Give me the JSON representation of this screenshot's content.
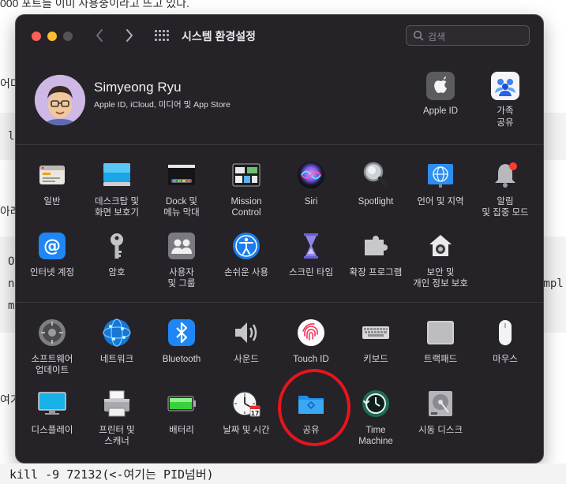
{
  "background": {
    "top_text": "000 포트를 이미 사용중이라고 뜨고 있다.",
    "left_fragments": [
      "어미",
      "l",
      "아래",
      "O",
      "n",
      "m",
      "여기"
    ],
    "right_fragment": "mmpl",
    "bottom_command": "kill -9 72132",
    "bottom_comment_prefix": "(<-여기는 ",
    "bottom_comment_kw": "PID",
    "bottom_comment_suffix": "넘버)"
  },
  "window": {
    "title": "시스템 환경설정",
    "back_label": "‹",
    "forward_label": "›",
    "search_placeholder": "검색"
  },
  "profile": {
    "name": "Simyeong Ryu",
    "subtitle": "Apple ID, iCloud, 미디어 및 App Store",
    "apple_id_label": "Apple ID",
    "family_label": "가족\n공유"
  },
  "section1": [
    {
      "label": "일반",
      "icon": "general-icon"
    },
    {
      "label": "데스크탑 및\n화면 보호기",
      "icon": "desktop-icon"
    },
    {
      "label": "Dock 및\n메뉴 막대",
      "icon": "dock-icon"
    },
    {
      "label": "Mission\nControl",
      "icon": "mission-control-icon"
    },
    {
      "label": "Siri",
      "icon": "siri-icon"
    },
    {
      "label": "Spotlight",
      "icon": "spotlight-icon"
    },
    {
      "label": "언어 및 지역",
      "icon": "language-icon"
    },
    {
      "label": "알림\n및 집중 모드",
      "icon": "notification-icon"
    },
    {
      "label": "인터넷 계정",
      "icon": "internet-accounts-icon"
    },
    {
      "label": "암호",
      "icon": "passwords-icon"
    },
    {
      "label": "사용자\n및 그룹",
      "icon": "users-icon"
    },
    {
      "label": "손쉬운 사용",
      "icon": "accessibility-icon"
    },
    {
      "label": "스크린 타임",
      "icon": "screen-time-icon"
    },
    {
      "label": "확장 프로그램",
      "icon": "extensions-icon"
    },
    {
      "label": "보안 및\n개인 정보 보호",
      "icon": "security-icon"
    }
  ],
  "section2": [
    {
      "label": "소프트웨어\n업데이트",
      "icon": "software-update-icon"
    },
    {
      "label": "네트워크",
      "icon": "network-icon"
    },
    {
      "label": "Bluetooth",
      "icon": "bluetooth-icon"
    },
    {
      "label": "사운드",
      "icon": "sound-icon"
    },
    {
      "label": "Touch ID",
      "icon": "touch-id-icon"
    },
    {
      "label": "키보드",
      "icon": "keyboard-icon"
    },
    {
      "label": "트랙패드",
      "icon": "trackpad-icon"
    },
    {
      "label": "마우스",
      "icon": "mouse-icon"
    },
    {
      "label": "디스플레이",
      "icon": "display-icon"
    },
    {
      "label": "프린터 및\n스캐너",
      "icon": "printer-icon"
    },
    {
      "label": "배터리",
      "icon": "battery-icon"
    },
    {
      "label": "날짜 및 시간",
      "icon": "date-time-icon"
    },
    {
      "label": "공유",
      "icon": "sharing-icon"
    },
    {
      "label": "Time\nMachine",
      "icon": "time-machine-icon"
    },
    {
      "label": "시동 디스크",
      "icon": "startup-disk-icon"
    }
  ],
  "calendar_day": "17",
  "colors": {
    "highlight_circle": "#e8141c",
    "window_bg": "#252328"
  }
}
